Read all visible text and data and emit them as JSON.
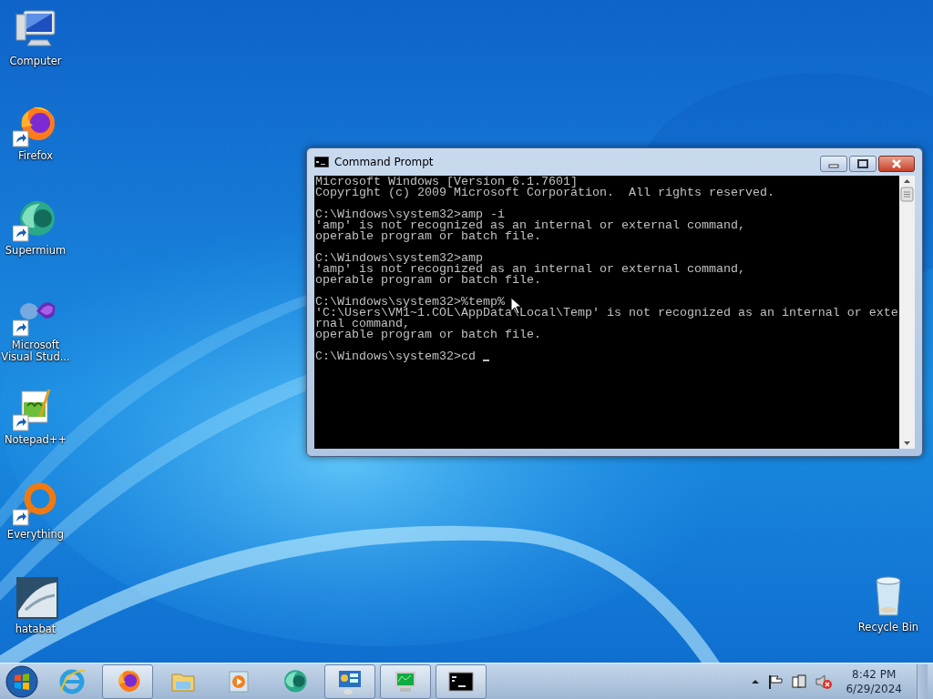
{
  "desktop_icons": [
    {
      "label": "Computer",
      "shortcut": false
    },
    {
      "label": "Firefox",
      "shortcut": true
    },
    {
      "label": "Supermium",
      "shortcut": true
    },
    {
      "label": "Microsoft Visual Stud...",
      "shortcut": true
    },
    {
      "label": "Notepad++",
      "shortcut": true
    },
    {
      "label": "Everything",
      "shortcut": true
    },
    {
      "label": "hatabat",
      "shortcut": false
    }
  ],
  "recycle_bin": {
    "label": "Recycle Bin"
  },
  "window": {
    "title": "Command Prompt",
    "console_blocks": [
      [
        "Microsoft Windows [Version 6.1.7601]",
        "Copyright (c) 2009 Microsoft Corporation.  All rights reserved."
      ],
      [
        "C:\\Windows\\system32>amp -i",
        "'amp' is not recognized as an internal or external command,",
        "operable program or batch file."
      ],
      [
        "C:\\Windows\\system32>amp",
        "'amp' is not recognized as an internal or external command,",
        "operable program or batch file."
      ],
      [
        "C:\\Windows\\system32>%temp%",
        "'C:\\Users\\VM1~1.COL\\AppData\\Local\\Temp' is not recognized as an internal or exte",
        "rnal command,",
        "operable program or batch file."
      ],
      [
        "C:\\Windows\\system32>cd "
      ]
    ]
  },
  "taskbar": {
    "items": [
      {
        "running": false
      },
      {
        "running": true
      },
      {
        "running": false
      },
      {
        "running": false
      },
      {
        "running": false
      },
      {
        "running": true
      },
      {
        "running": true
      },
      {
        "running": true
      }
    ],
    "clock": {
      "time": "8:42 PM",
      "date": "6/29/2024"
    }
  }
}
